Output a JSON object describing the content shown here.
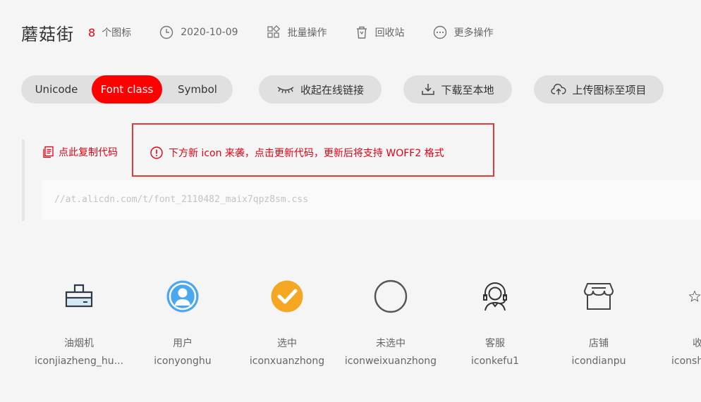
{
  "header": {
    "project_name": "蘑菇街",
    "icon_count": "8",
    "icon_count_label": "个图标",
    "date": "2020-10-09",
    "batch_ops": "批量操作",
    "recycle_bin": "回收站",
    "more_ops": "更多操作"
  },
  "tabs": {
    "unicode": "Unicode",
    "font_class": "Font class",
    "symbol": "Symbol",
    "active": "Font class"
  },
  "actions": {
    "collapse_link": "收起在线链接",
    "download_local": "下载至本地",
    "upload_to_project": "上传图标至项目"
  },
  "code": {
    "copy_label": "点此复制代码",
    "notice": "下方新 icon 来袭，点击更新代码，更新后将支持 WOFF2 格式",
    "url": "//at.alicdn.com/t/font_2110482_maix7qpz8sm.css"
  },
  "icons": [
    {
      "name": "油烟机",
      "code": "iconjiazheng_hu...",
      "icon": "range-hood-icon"
    },
    {
      "name": "用户",
      "code": "iconyonghu",
      "icon": "user-icon"
    },
    {
      "name": "选中",
      "code": "iconxuanzhong",
      "icon": "checked-icon"
    },
    {
      "name": "未选中",
      "code": "iconweixuanzhong",
      "icon": "unchecked-icon"
    },
    {
      "name": "客服",
      "code": "iconkefu1",
      "icon": "customer-service-icon"
    },
    {
      "name": "店铺",
      "code": "icondianpu",
      "icon": "shop-icon"
    },
    {
      "name": "收",
      "code": "iconsh",
      "icon": "star-icon"
    }
  ],
  "colors": {
    "accent": "#ff0000",
    "user_blue": "#4aa8f0",
    "check_orange": "#f5a623"
  }
}
